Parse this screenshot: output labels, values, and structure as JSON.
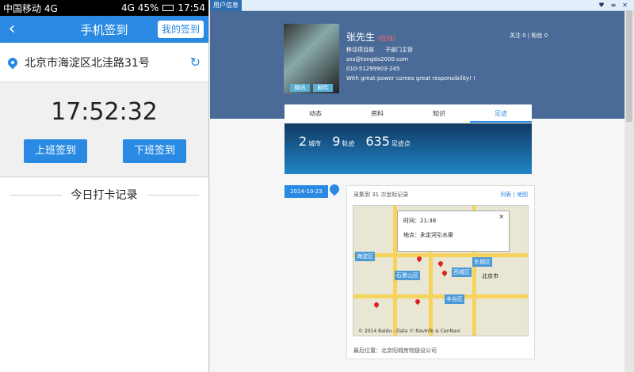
{
  "phone": {
    "status": {
      "left": "中国移动 4G",
      "right": "4G 45%",
      "time": "17:54"
    },
    "appbar": {
      "title": "手机签到",
      "my_button": "我的签到"
    },
    "location": {
      "address": "北京市海淀区北洼路31号"
    },
    "clock": "17:52:32",
    "buttons": {
      "checkin": "上班签到",
      "checkout": "下班签到"
    },
    "records_title": "今日打卡记录"
  },
  "pc": {
    "window_title": "用户信息",
    "profile": {
      "name": "张先生",
      "online": "(在线)",
      "department": "移动项目部",
      "role": "子部门主管",
      "email": "zxs@tongda2000.com",
      "phone": "010-51299903-245",
      "motto": "With great power comes great responsibility! !",
      "buttons": {
        "msg": "微讯",
        "mail": "邮件"
      }
    },
    "follows": {
      "following": "关注 0",
      "followers": "粉丝 0"
    },
    "tabs": [
      "动态",
      "资料",
      "知识",
      "足迹"
    ],
    "stats": {
      "cities": "2",
      "cities_label": "城市",
      "tracks": "9",
      "tracks_label": "轨迹",
      "points": "635",
      "points_label": "足迹点"
    },
    "feed": {
      "date": "2014-10-23",
      "title": "采集到 31 次坐标记录",
      "view_toggle": "列表 | 地图",
      "popup_time": "时间：21:38",
      "popup_place": "地点：永定河引水渠",
      "last_position": "最后位置：北京阳城房物链设公司",
      "map_labels": [
        "东城区",
        "西城区",
        "石景山区",
        "丰台区",
        "海淀区",
        "北京市"
      ],
      "copyright": "© 2014 Baidu - Data © NavInfo & CenNavi"
    }
  },
  "colors": {
    "accent": "#2a8ae3",
    "header": "#4a6b98"
  }
}
